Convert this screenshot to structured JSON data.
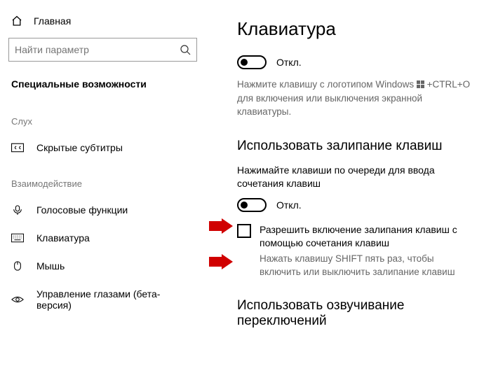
{
  "sidebar": {
    "home": "Главная",
    "search_placeholder": "Найти параметр",
    "section": "Специальные возможности",
    "group_sluh": "Слух",
    "item_subtitles": "Скрытые субтитры",
    "group_interaction": "Взаимодействие",
    "item_voice": "Голосовые функции",
    "item_keyboard": "Клавиатура",
    "item_mouse": "Мышь",
    "item_eye": "Управление глазами (бета-версия)"
  },
  "main": {
    "title": "Клавиатура",
    "toggle1_state": "Откл.",
    "desc1_a": "Нажмите клавишу с логотипом Windows",
    "desc1_b": "+CTRL+O для включения или выключения экранной клавиатуры.",
    "h2_sticky": "Использовать залипание клавиш",
    "sticky_desc": "Нажимайте клавиши по очереди для ввода сочетания клавиш",
    "toggle2_state": "Откл.",
    "sticky_check_label": "Разрешить включение залипания клавиш с помощью сочетания клавиш",
    "sticky_check_sub": "Нажать клавишу SHIFT пять раз, чтобы включить или выключить залипание клавиш",
    "h2_toggle_keys": "Использовать озвучивание переключений"
  }
}
